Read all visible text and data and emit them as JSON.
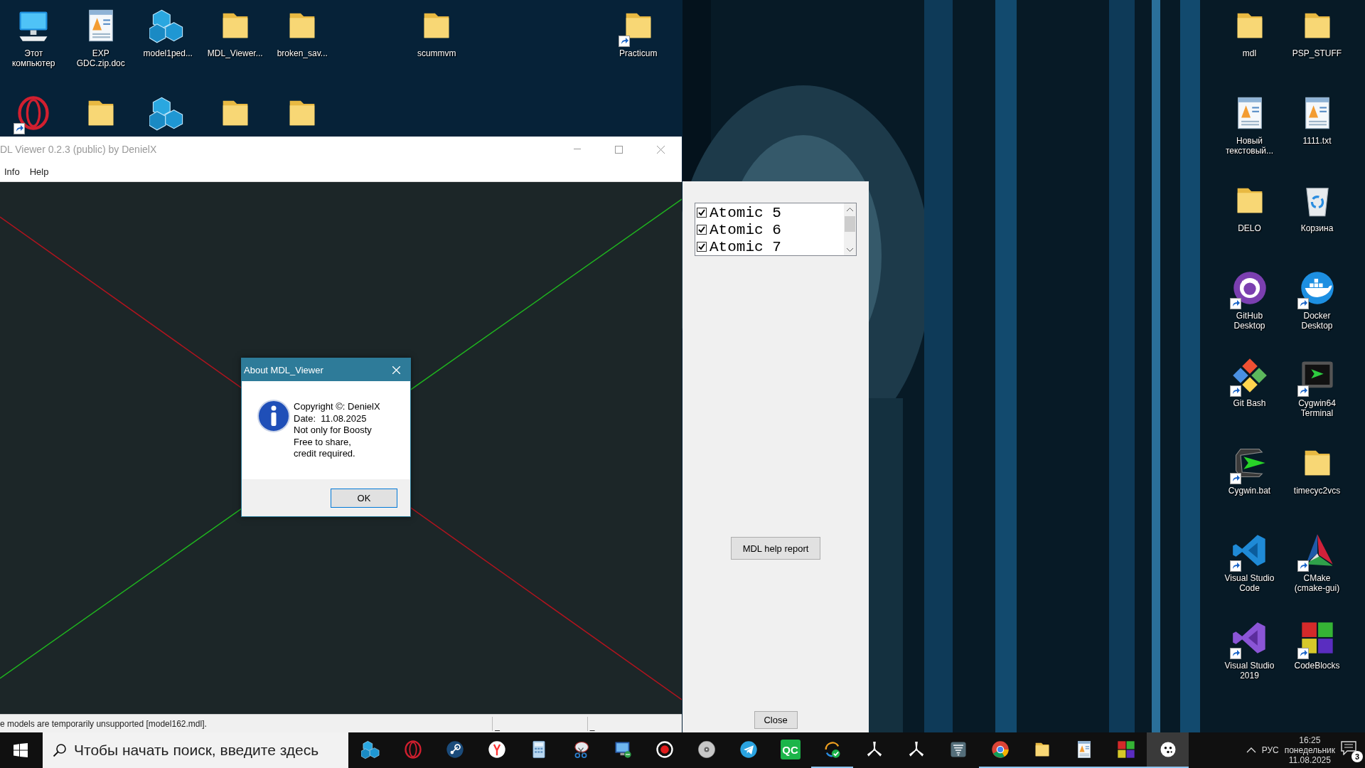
{
  "desktop": {
    "left_icons": [
      {
        "kind": "computer",
        "label": "Этот компьютер",
        "shortcut": false
      },
      {
        "kind": "document",
        "label": "EXP GDC.zip.doc",
        "shortcut": false
      },
      {
        "kind": "cubes",
        "label": "model1ped...",
        "shortcut": false
      },
      {
        "kind": "folder",
        "label": "MDL_Viewer...",
        "shortcut": false
      },
      {
        "kind": "folder",
        "label": "broken_sav...",
        "shortcut": false
      },
      {
        "kind": "folder",
        "label": "scummvm",
        "shortcut": false
      },
      {
        "kind": "folder",
        "label": "Practicum",
        "shortcut": true
      },
      {
        "kind": "ring",
        "shortcut": true
      },
      {
        "kind": "folder",
        "shortcut": false
      },
      {
        "kind": "cubes",
        "shortcut": false
      },
      {
        "kind": "folder",
        "shortcut": false
      },
      {
        "kind": "folder",
        "shortcut": false
      }
    ],
    "right_icons": [
      {
        "kind": "folder",
        "label": "mdl",
        "shortcut": false
      },
      {
        "kind": "folder",
        "label": "PSP_STUFF",
        "shortcut": false
      },
      {
        "kind": "document",
        "label": "Новый текстовый...",
        "shortcut": false
      },
      {
        "kind": "document",
        "label": "1111.txt",
        "shortcut": false
      },
      {
        "kind": "folder",
        "label": "DELO",
        "shortcut": false
      },
      {
        "kind": "recycle",
        "label": "Корзина",
        "shortcut": false
      },
      {
        "kind": "github",
        "label": "GitHub Desktop",
        "shortcut": true
      },
      {
        "kind": "docker",
        "label": "Docker Desktop",
        "shortcut": true
      },
      {
        "kind": "gitbash",
        "label": "Git Bash",
        "shortcut": true
      },
      {
        "kind": "terminal",
        "label": "Cygwin64 Terminal",
        "shortcut": true
      },
      {
        "kind": "cygwin",
        "label": "Cygwin.bat",
        "shortcut": true
      },
      {
        "kind": "folder",
        "label": "timecyc2vcs",
        "shortcut": false
      },
      {
        "kind": "vscode",
        "label": "Visual Studio Code",
        "shortcut": true
      },
      {
        "kind": "cmake",
        "label": "CMake (cmake-gui)",
        "shortcut": true
      },
      {
        "kind": "vs",
        "label": "Visual Studio 2019",
        "shortcut": true
      },
      {
        "kind": "codeblocks",
        "label": "CodeBlocks",
        "shortcut": true
      }
    ]
  },
  "window": {
    "title": "DL Viewer 0.2.3 (public) by DenielX",
    "menu": [
      "Info",
      "Help"
    ],
    "status_bar": {
      "message": "e models are temporarily unsupported [model162.mdl].",
      "panes": [
        "_",
        "_"
      ]
    }
  },
  "side_panel": {
    "atomics": [
      {
        "label": "Atomic 5",
        "checked": true
      },
      {
        "label": "Atomic 6",
        "checked": true
      },
      {
        "label": "Atomic 7",
        "checked": true
      }
    ],
    "report_button": "MDL help report",
    "close_button": "Close"
  },
  "dialog": {
    "title": "About MDL_Viewer",
    "lines": [
      "Copyright ©: DenielX",
      "Date:  11.08.2025",
      "Not only for Boosty",
      "Free to share,",
      "credit required."
    ],
    "ok_button": "OK"
  },
  "taskbar": {
    "search": {
      "placeholder": "Чтобы начать поиск, введите здесь"
    },
    "apps": [
      {
        "kind": "cubes",
        "running": false,
        "selected": false
      },
      {
        "kind": "ring",
        "running": false,
        "selected": false
      },
      {
        "kind": "steam",
        "running": false,
        "selected": false
      },
      {
        "kind": "yandex",
        "running": false,
        "selected": false
      },
      {
        "kind": "calculator",
        "running": false,
        "selected": false
      },
      {
        "kind": "snipping",
        "running": false,
        "selected": false
      },
      {
        "kind": "remote",
        "running": false,
        "selected": false
      },
      {
        "kind": "record",
        "running": false,
        "selected": false
      },
      {
        "kind": "disc",
        "running": false,
        "selected": false
      },
      {
        "kind": "telegram",
        "running": false,
        "selected": false
      },
      {
        "kind": "qc",
        "label": "QC",
        "running": false,
        "selected": false
      },
      {
        "kind": "update",
        "running": true,
        "selected": false
      },
      {
        "kind": "fan",
        "running": false,
        "selected": false
      },
      {
        "kind": "fan",
        "running": false,
        "selected": false
      },
      {
        "kind": "tornado",
        "running": false,
        "selected": false
      },
      {
        "kind": "chrome",
        "running": true,
        "selected": false
      },
      {
        "kind": "folder",
        "running": true,
        "selected": false
      },
      {
        "kind": "document",
        "running": true,
        "selected": false
      },
      {
        "kind": "codeblocks",
        "running": true,
        "selected": false
      },
      {
        "kind": "bot",
        "running": true,
        "selected": true
      }
    ],
    "tray": {
      "language": "РУС",
      "time": "16:25",
      "day": "понедельник",
      "date": "11.08.2025",
      "notifications": "3"
    }
  }
}
